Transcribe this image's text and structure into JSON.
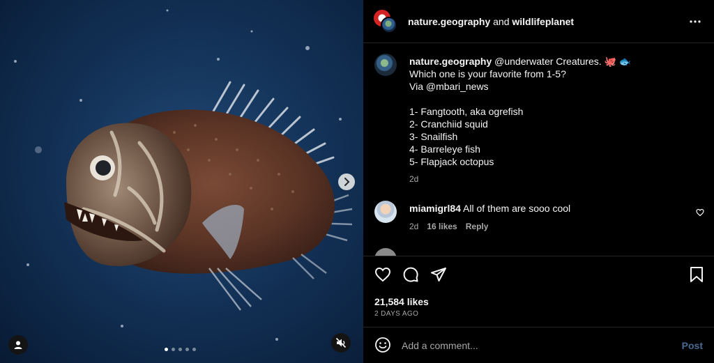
{
  "media": {
    "description_icon": "fish-photo",
    "next_icon": "chevron-right-icon",
    "tag_icon": "user-icon",
    "mute_icon": "speaker-muted-icon",
    "carousel": {
      "count": 5,
      "active_index": 0
    }
  },
  "header": {
    "account_1": "nature.geography",
    "joiner": " and ",
    "account_2": "wildlifeplanet",
    "more_icon": "ellipsis-icon"
  },
  "caption": {
    "username": "nature.geography",
    "first_line": " @underwater Creatures. 🐙 🐟",
    "lines": [
      "Which one is your favorite from 1-5?",
      "Via @mbari_news",
      "",
      "1- Fangtooth, aka ogrefish",
      "2- Cranchiid squid",
      "3- Snailfish",
      "4- Barreleye fish",
      "5- Flapjack octopus"
    ],
    "time": "2d"
  },
  "comments": [
    {
      "username": "miamigrl84",
      "text": " All of them are sooo cool",
      "time": "2d",
      "likes": "16 likes",
      "reply": "Reply"
    },
    {
      "username": "",
      "text": ""
    }
  ],
  "actions": {
    "like_icon": "heart-icon",
    "comment_icon": "comment-icon",
    "share_icon": "paper-plane-icon",
    "save_icon": "bookmark-icon",
    "likes": "21,584 likes",
    "time_ago": "2 DAYS AGO"
  },
  "composer": {
    "emoji_icon": "smiley-icon",
    "placeholder": "Add a comment...",
    "post_label": "Post"
  },
  "colors": {
    "background": "#000000",
    "divider": "#262626",
    "muted_text": "#a8a8a8",
    "post_button": "#4a6a93",
    "ocean": "#14345a"
  }
}
